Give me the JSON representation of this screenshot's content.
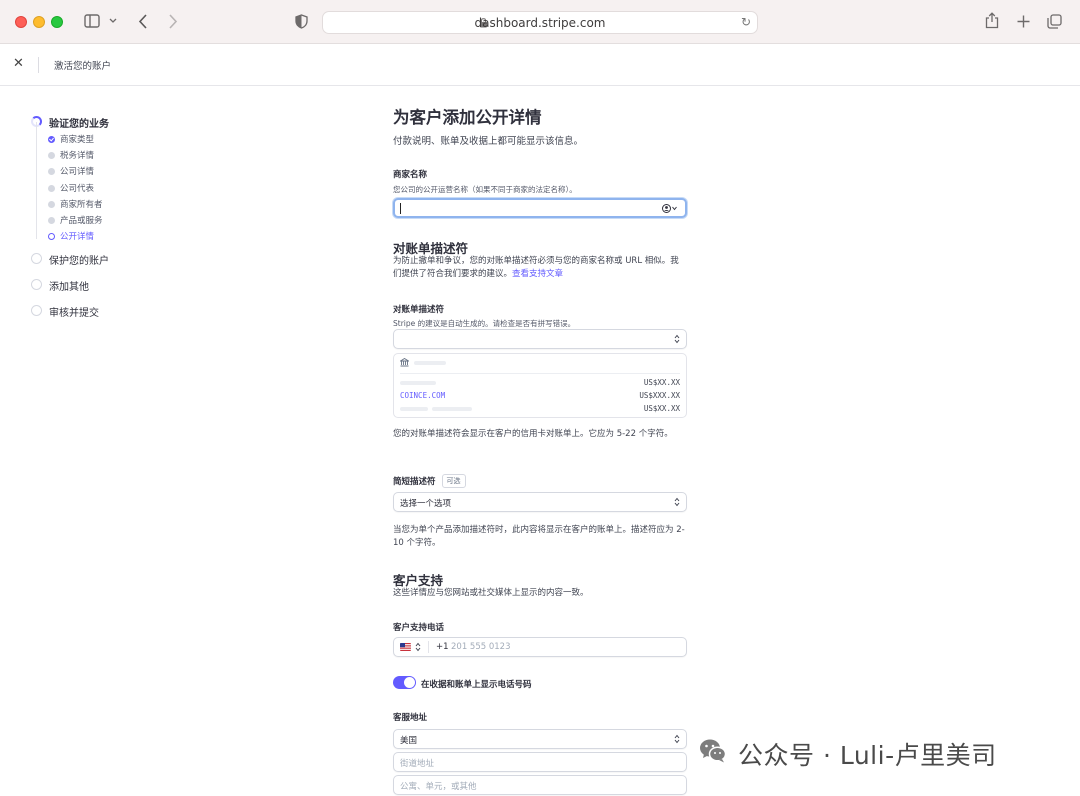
{
  "browser": {
    "url": "dashboard.stripe.com"
  },
  "header": {
    "close_icon": "close-icon",
    "title": "激活您的账户"
  },
  "sidebar": {
    "steps": [
      {
        "label": "验证您的业务",
        "state": "in-progress"
      },
      {
        "label": "保护您的账户",
        "state": "pending"
      },
      {
        "label": "添加其他",
        "state": "pending"
      },
      {
        "label": "审核并提交",
        "state": "pending"
      }
    ],
    "substeps": [
      {
        "label": "商家类型",
        "state": "done"
      },
      {
        "label": "税务详情",
        "state": "pending"
      },
      {
        "label": "公司详情",
        "state": "pending"
      },
      {
        "label": "公司代表",
        "state": "pending"
      },
      {
        "label": "商家所有者",
        "state": "pending"
      },
      {
        "label": "产品或服务",
        "state": "pending"
      },
      {
        "label": "公开详情",
        "state": "current"
      }
    ]
  },
  "main": {
    "title": "为客户添加公开详情",
    "subtitle": "付款说明、账单及收据上都可能显示该信息。",
    "business_name": {
      "label": "商家名称",
      "help": "您公司的公开运营名称（如果不同于商家的法定名称）。",
      "value": ""
    },
    "statement": {
      "heading": "对账单描述符",
      "intro": "为防止撤单和争议，您的对账单描述符必须与您的商家名称或 URL 相似。我们提供了符合我们要求的建议。",
      "link": "查看支持文章",
      "field_label": "对账单描述符",
      "field_help": "Stripe 的建议是自动生成的。请检查是否有拼写错误。",
      "value": "",
      "preview": {
        "bank_icon": "bank-icon",
        "rows": [
          {
            "desc": "",
            "amount": "US$XX.XX"
          },
          {
            "desc": "COINCE.COM",
            "amount": "US$XXX.XX"
          },
          {
            "desc": "",
            "amount": "US$XX.XX"
          }
        ]
      },
      "note": "您的对账单描述符会显示在客户的信用卡对账单上。它应为 5-22 个字符。"
    },
    "short_descriptor": {
      "label": "简短描述符",
      "badge": "可选",
      "value": "选择一个选项",
      "note": "当您为单个产品添加描述符时，此内容将显示在客户的账单上。描述符应为 2-10 个字符。"
    },
    "support": {
      "heading": "客户支持",
      "intro": "这些详情应与您网站或社交媒体上显示的内容一致。",
      "phone_label": "客户支持电话",
      "phone_prefix": "+1",
      "phone_placeholder": "201 555 0123",
      "toggle_label": "在收据和账单上显示电话号码",
      "toggle_on": true,
      "address_label": "客服地址",
      "country": "美国",
      "street_placeholder": "街道地址",
      "unit_placeholder": "公寓、单元，或其他"
    }
  },
  "watermark": {
    "text": "公众号 · Luli-卢里美司"
  },
  "colors": {
    "accent": "#635bff",
    "text": "#30313d",
    "border": "#d5d8e0"
  }
}
